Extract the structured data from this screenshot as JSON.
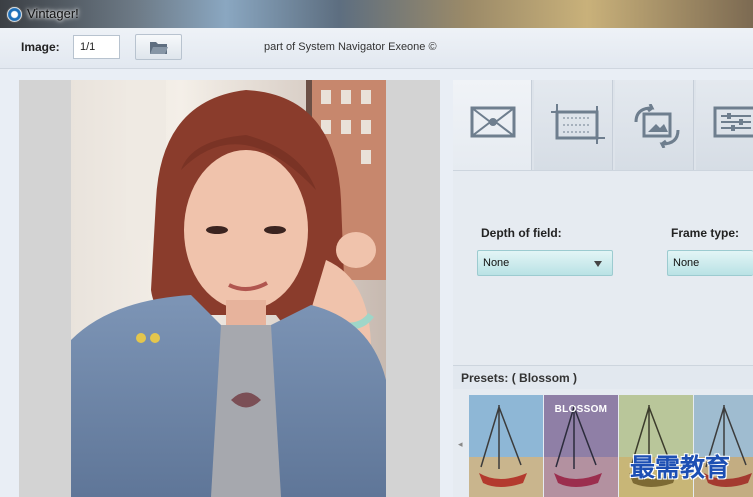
{
  "window": {
    "title": "Vintager!"
  },
  "toolbar": {
    "image_label": "Image:",
    "image_value": "1/1",
    "credit": "part of System Navigator Exeone ©"
  },
  "settings": {
    "depth_of_field_label": "Depth of field:",
    "depth_of_field_value": "None",
    "frame_type_label": "Frame type:",
    "frame_type_value": "None"
  },
  "presets": {
    "label": "Presets: ( Blossom )",
    "items": [
      {
        "title": ""
      },
      {
        "title": "BLOSSOM"
      },
      {
        "title": ""
      },
      {
        "title": ""
      }
    ]
  },
  "watermark": "最需教育",
  "icons": {
    "app": "app-icon",
    "open": "open-folder-icon",
    "tabs": [
      "envelope-effect-icon",
      "crop-frame-icon",
      "rotate-image-icon",
      "adjust-sliders-icon"
    ]
  }
}
